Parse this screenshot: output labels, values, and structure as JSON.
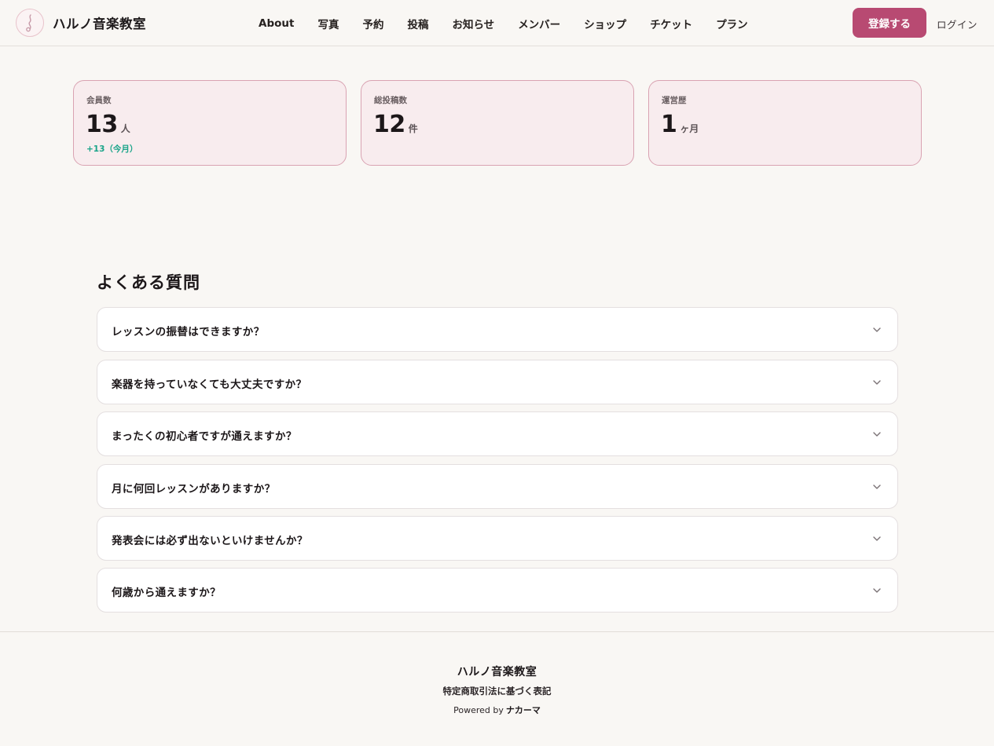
{
  "header": {
    "brand": "ハルノ音楽教室",
    "nav": [
      "About",
      "写真",
      "予約",
      "投稿",
      "お知らせ",
      "メンバー",
      "ショップ",
      "チケット",
      "プラン"
    ],
    "register_label": "登録する",
    "login_label": "ログイン"
  },
  "colors": {
    "accent": "#b84a72",
    "card_bg": "#f8ecee",
    "card_border": "#d9a3b2",
    "delta": "#1aa489",
    "page_bg": "#f9f7f4"
  },
  "stats": [
    {
      "label": "会員数",
      "value": "13",
      "unit": "人",
      "delta": "+13（今月）"
    },
    {
      "label": "総投稿数",
      "value": "12",
      "unit": "件"
    },
    {
      "label": "運営歴",
      "value": "1",
      "unit": "ヶ月"
    }
  ],
  "faq": {
    "title": "よくある質問",
    "items": [
      "レッスンの振替はできますか？",
      "楽器を持っていなくても大丈夫ですか？",
      "まったくの初心者ですが通えますか？",
      "月に何回レッスンがありますか？",
      "発表会には必ず出ないといけませんか？",
      "何歳から通えますか？"
    ]
  },
  "footer": {
    "name": "ハルノ音楽教室",
    "legal": "特定商取引法に基づく表記",
    "powered_prefix": "Powered by",
    "powered_brand": "ナカーマ"
  }
}
